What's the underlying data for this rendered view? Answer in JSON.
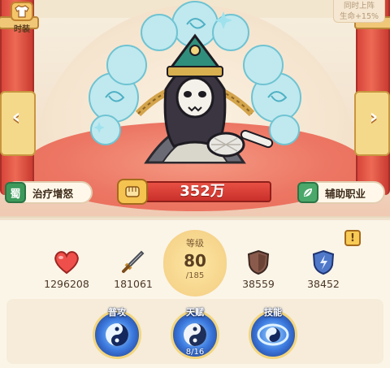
{
  "header": {
    "costume_label": "时装",
    "bonus_line1": "同时上阵",
    "bonus_line2": "生命+15%"
  },
  "hero": {
    "tag_left": {
      "badge": "蜀",
      "label": "治疗增怒"
    },
    "tag_right": {
      "label": "辅助职业"
    },
    "power": "352万"
  },
  "stats": {
    "hp": "1296208",
    "attack": "181061",
    "level_label": "等级",
    "level": "80",
    "level_max": "/185",
    "phys_def": "38559",
    "mag_def": "38452",
    "info": "!"
  },
  "skills": [
    {
      "label": "普攻",
      "sub": ""
    },
    {
      "label": "天赋",
      "sub": "8/16"
    },
    {
      "label": "技能",
      "sub": ""
    }
  ],
  "colors": {
    "accent_red": "#e85044",
    "gold": "#f5c34f",
    "faction_green": "#3d9a5c"
  },
  "icons": [
    "shirt-icon",
    "chevron-left-icon",
    "chevron-right-icon",
    "fist-icon",
    "leaf-icon",
    "heart-icon",
    "sword-icon",
    "shield-icon",
    "magic-shield-icon",
    "info-icon",
    "yin-yang-icon"
  ]
}
